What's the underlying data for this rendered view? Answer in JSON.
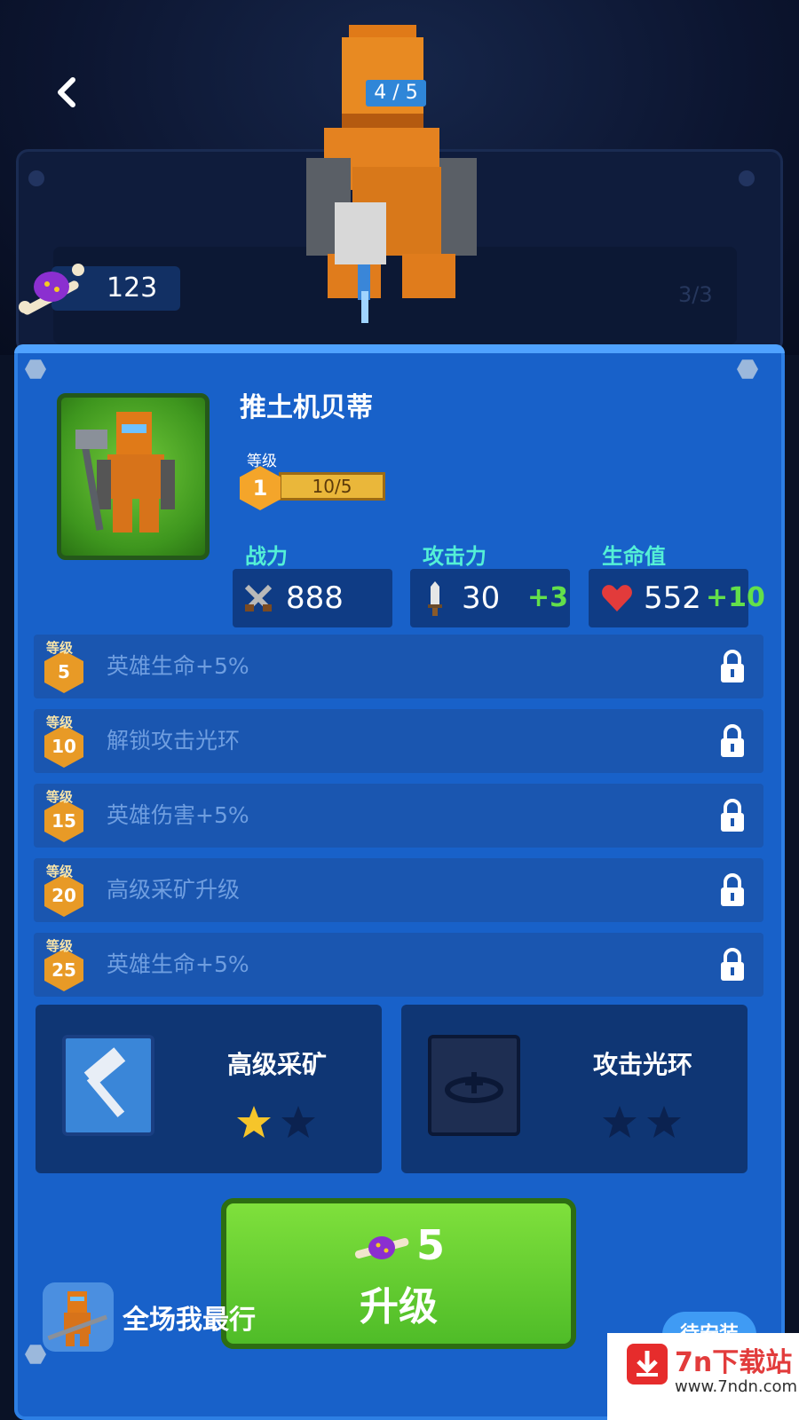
{
  "header": {
    "counter": "4 / 5",
    "faint_counter": "3/3"
  },
  "currency": {
    "amount": "123"
  },
  "hero": {
    "name": "推土机贝蒂",
    "level_label": "等级",
    "level": "1",
    "level_progress_text": "10/5"
  },
  "stats": [
    {
      "label": "战力",
      "value": "888",
      "bonus": "",
      "icon": "power-icon"
    },
    {
      "label": "攻击力",
      "value": "30",
      "bonus": "+3",
      "icon": "sword-icon"
    },
    {
      "label": "生命值",
      "value": "552",
      "bonus": "+10",
      "icon": "heart-icon"
    }
  ],
  "unlocks": [
    {
      "level_label": "等级",
      "level": "5",
      "text": "英雄生命+5%"
    },
    {
      "level_label": "等级",
      "level": "10",
      "text": "解锁攻击光环"
    },
    {
      "level_label": "等级",
      "level": "15",
      "text": "英雄伤害+5%"
    },
    {
      "level_label": "等级",
      "level": "20",
      "text": "高级采矿升级"
    },
    {
      "level_label": "等级",
      "level": "25",
      "text": "英雄生命+5%"
    }
  ],
  "skills": [
    {
      "name": "高级采矿",
      "stars_filled": 1,
      "stars_total": 2,
      "icon": "hammer-icon"
    },
    {
      "name": "攻击光环",
      "stars_filled": 0,
      "stars_total": 2,
      "icon": "aura-icon"
    }
  ],
  "upgrade": {
    "cost": "5",
    "label": "升级"
  },
  "ad": {
    "title": "全场我最行",
    "install_label": "待安装"
  },
  "watermark": {
    "title": "7n下载站",
    "url": "www.7ndn.com"
  },
  "colors": {
    "panel": "#1861c9",
    "upgrade_green": "#5cc62e",
    "stat_label": "#54f0d6",
    "bonus_green": "#63e04a"
  }
}
